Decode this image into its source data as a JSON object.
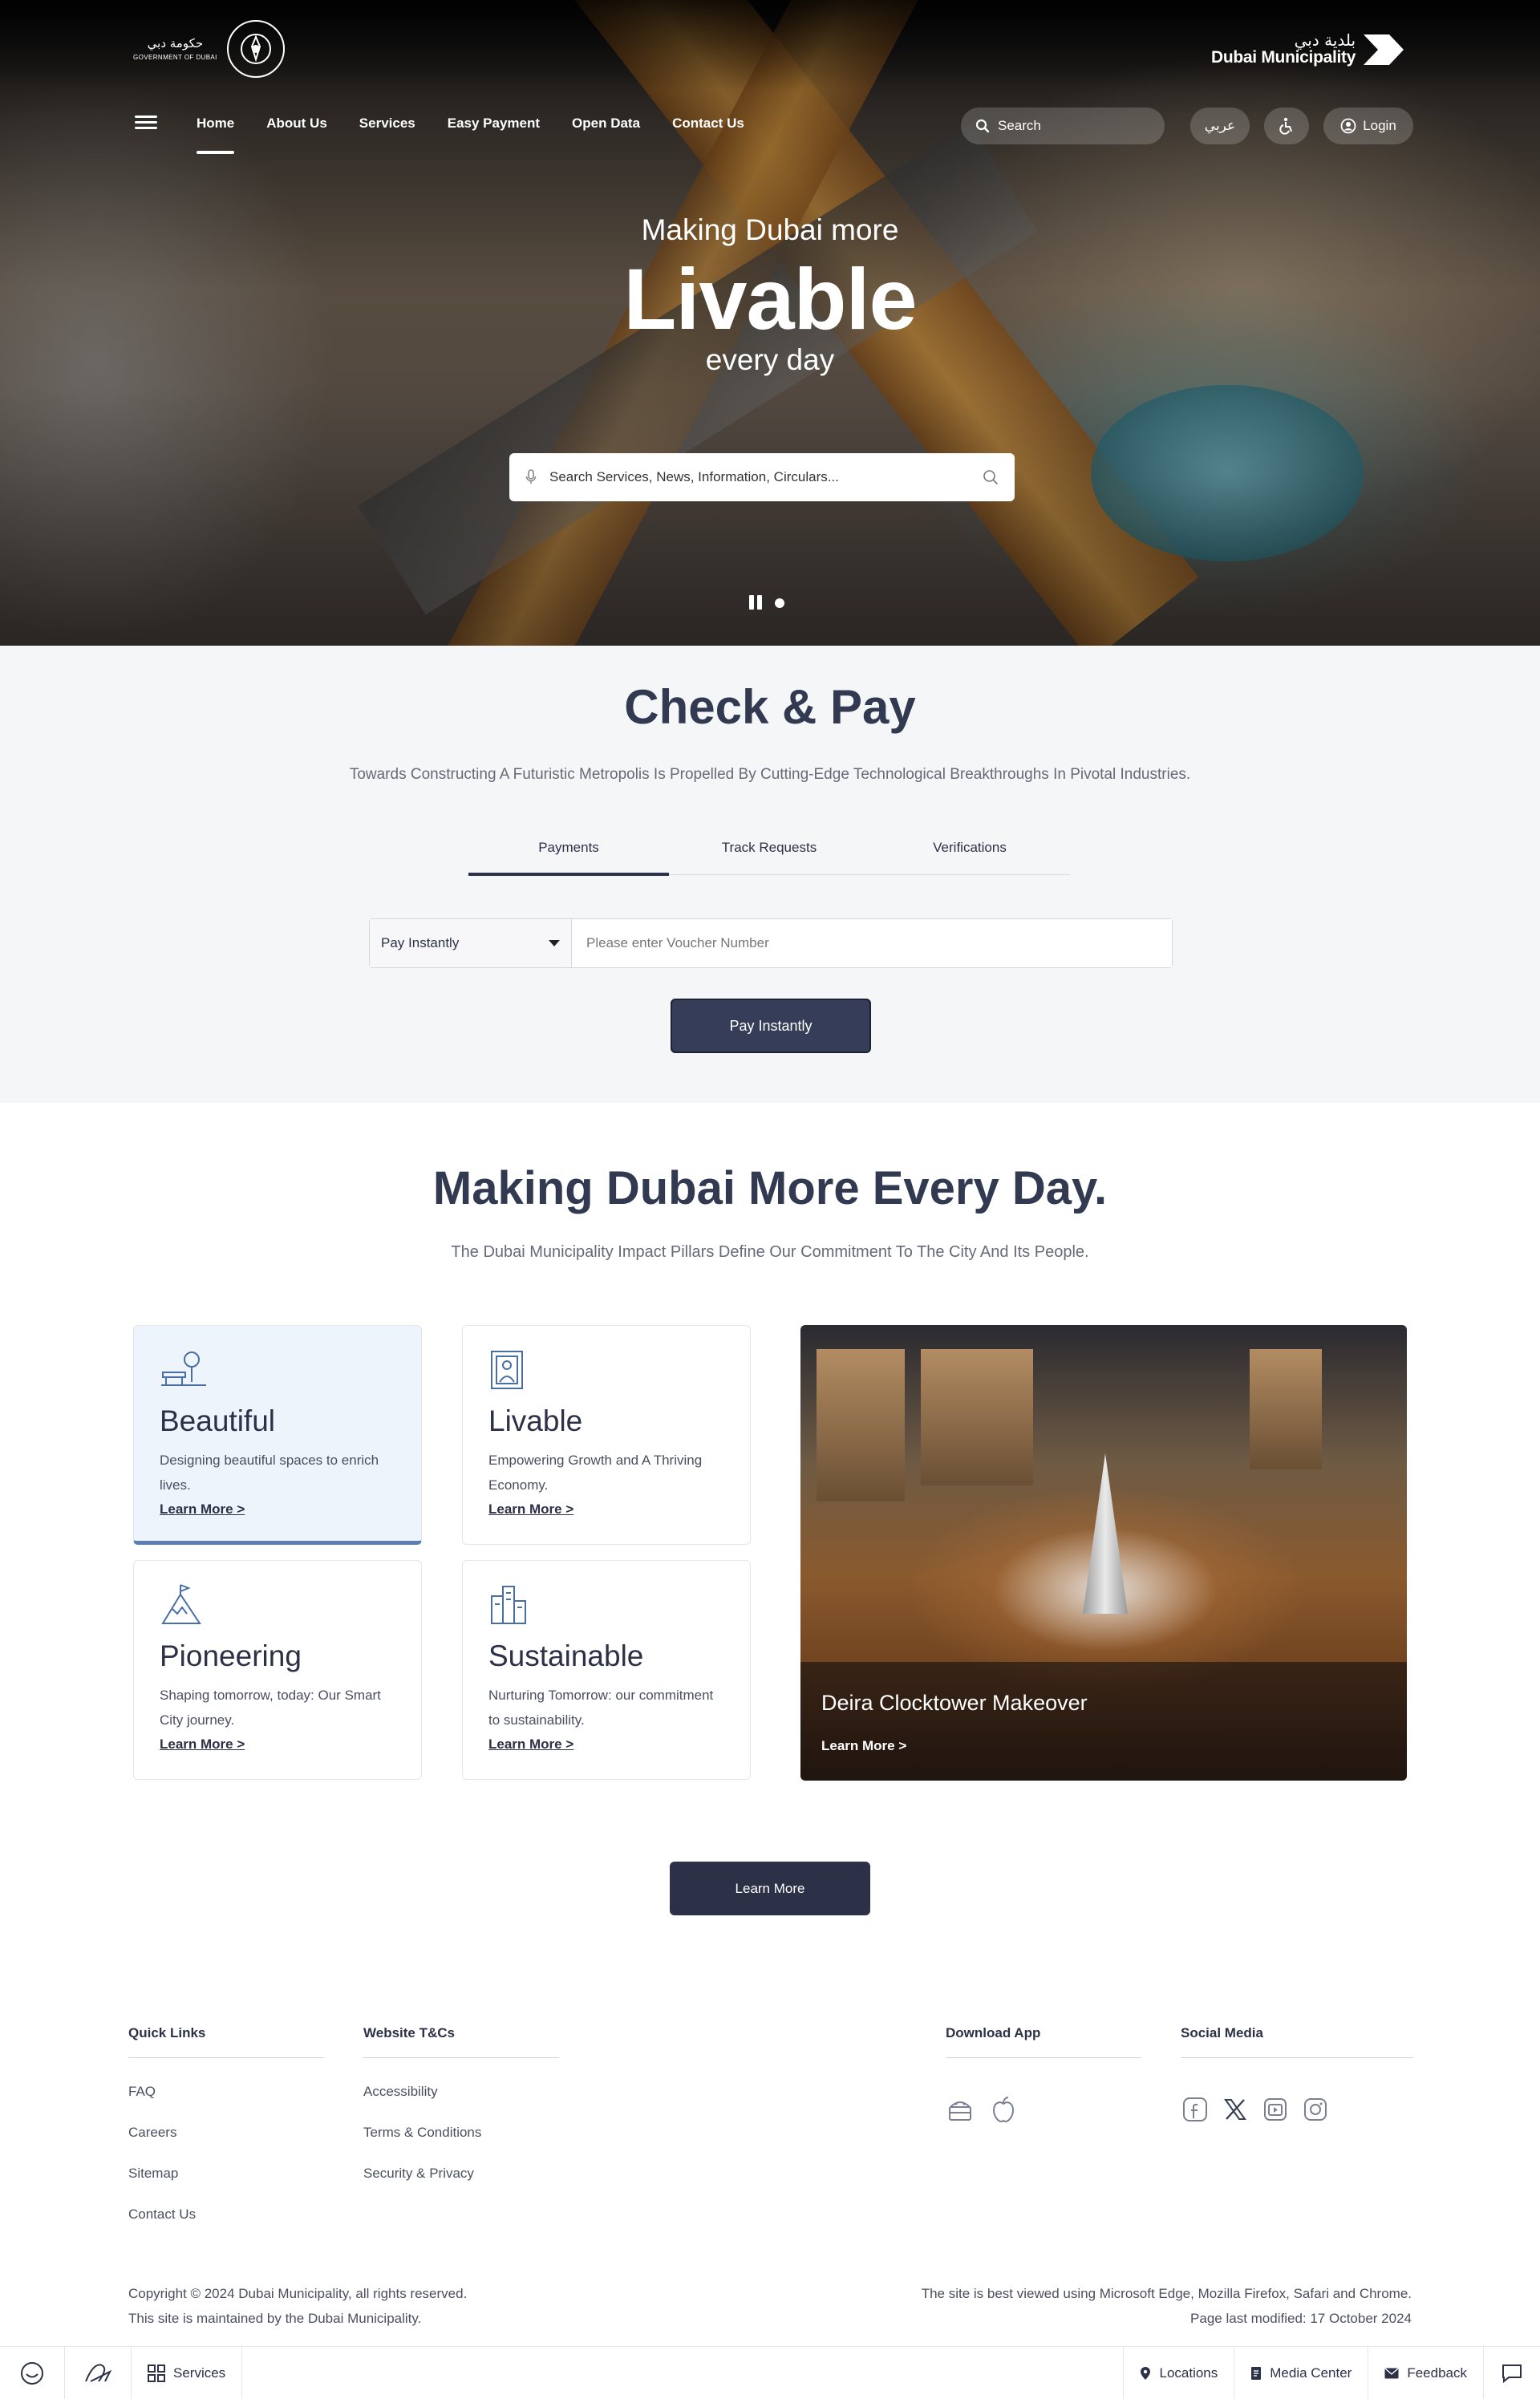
{
  "header": {
    "gov_logo_ar": "حكومة دبي",
    "gov_logo_en": "GOVERNMENT OF DUBAI",
    "dm_logo_ar": "بلدية دبي",
    "dm_logo_en": "Dubai Municipality",
    "nav": [
      {
        "label": "Home",
        "active": true
      },
      {
        "label": "About Us"
      },
      {
        "label": "Services"
      },
      {
        "label": "Easy Payment"
      },
      {
        "label": "Open Data"
      },
      {
        "label": "Contact Us"
      }
    ],
    "search_placeholder": "Search",
    "lang_label": "عربي",
    "login_label": "Login"
  },
  "hero": {
    "line1": "Making Dubai more",
    "highlight": "Livable",
    "line3": "every day",
    "search_placeholder": "Search Services, News, Information, Circulars..."
  },
  "check_pay": {
    "title": "Check & Pay",
    "description": "Towards Constructing A Futuristic Metropolis Is Propelled By Cutting-Edge Technological Breakthroughs In Pivotal Industries.",
    "tabs": [
      "Payments",
      "Track Requests",
      "Verifications"
    ],
    "active_tab": "Payments",
    "select_value": "Pay Instantly",
    "voucher_placeholder": "Please enter Voucher Number",
    "button_label": "Pay Instantly"
  },
  "making_dubai": {
    "title": "Making Dubai More Every Day.",
    "description": "The Dubai Municipality Impact Pillars Define Our Commitment To The City And Its People.",
    "pillars": [
      {
        "title": "Beautiful",
        "description": "Designing beautiful spaces to enrich lives.",
        "link": "Learn More >",
        "icon": "tree-bench-icon"
      },
      {
        "title": "Livable",
        "description": "Empowering Growth and A Thriving Economy.",
        "link": "Learn More >",
        "icon": "person-frame-icon"
      },
      {
        "title": "Pioneering",
        "description": "Shaping tomorrow, today: Our Smart City journey.",
        "link": "Learn More >",
        "icon": "mountain-flag-icon"
      },
      {
        "title": "Sustainable",
        "description": "Nurturing Tomorrow: our commitment to sustainability.",
        "link": "Learn More >",
        "icon": "buildings-icon"
      }
    ],
    "feature": {
      "title": "Deira Clocktower Makeover",
      "link": "Learn More >"
    },
    "button_label": "Learn More"
  },
  "footer": {
    "quick_links": {
      "heading": "Quick Links",
      "items": [
        "FAQ",
        "Careers",
        "Sitemap",
        "Contact Us"
      ]
    },
    "terms": {
      "heading": "Website T&Cs",
      "items": [
        "Accessibility",
        "Terms & Conditions",
        "Security & Privacy"
      ]
    },
    "download": {
      "heading": "Download App",
      "icons": [
        "android-icon",
        "apple-icon"
      ]
    },
    "social": {
      "heading": "Social Media",
      "icons": [
        "facebook-icon",
        "x-icon",
        "youtube-icon",
        "instagram-icon"
      ]
    },
    "copyright": "Copyright © 2024 Dubai Municipality, all rights reserved.",
    "maintained": "This site is maintained by the Dubai Municipality.",
    "browsers": "The site is best viewed using Microsoft Edge, Mozilla Firefox, Safari and Chrome.",
    "modified": "Page last modified: 17 October 2024"
  },
  "bottom_bar": {
    "services": "Services",
    "locations": "Locations",
    "media_center": "Media Center",
    "feedback": "Feedback"
  },
  "colors": {
    "primary": "#2c3147",
    "button": "#363d58",
    "accent": "#5b7fb3",
    "section_bg": "#f5f6f8"
  }
}
